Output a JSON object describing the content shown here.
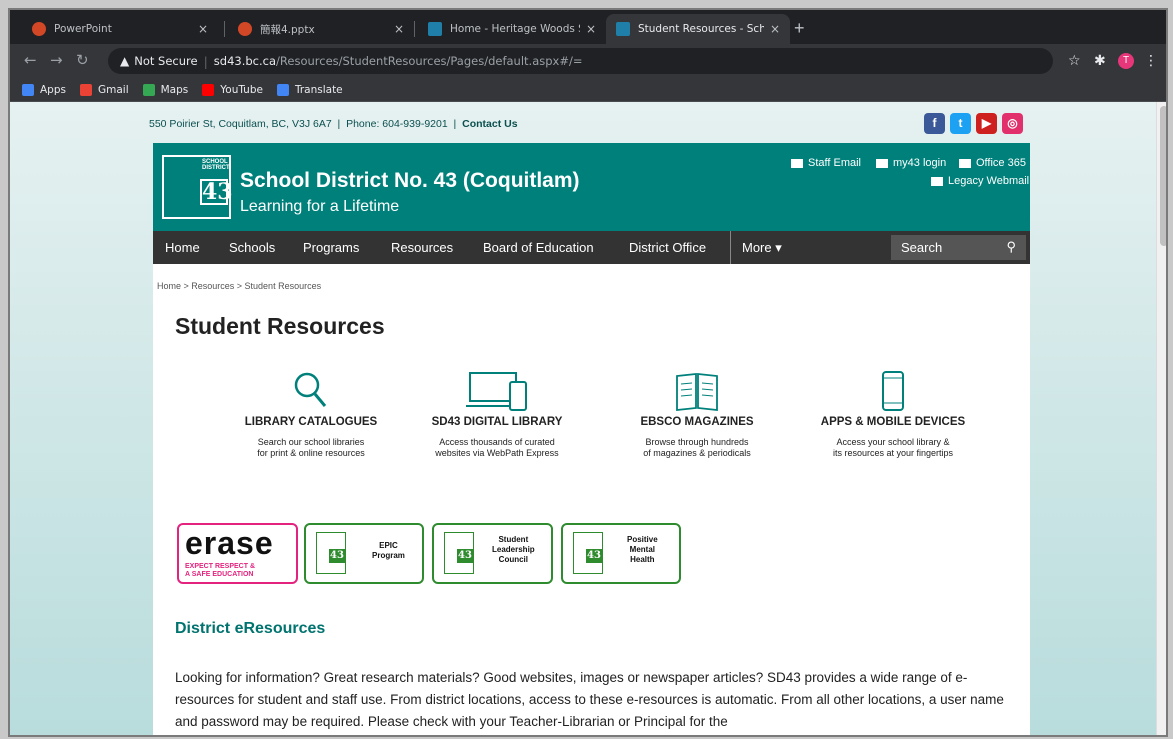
{
  "browser": {
    "tabs": [
      {
        "title": "PowerPoint",
        "icon": "powerpoint-icon",
        "active": false
      },
      {
        "title": "簡報4.pptx",
        "icon": "powerpoint-icon",
        "active": false
      },
      {
        "title": "Home - Heritage Woods Secon",
        "icon": "sd43-favicon",
        "active": false
      },
      {
        "title": "Student Resources - School Di",
        "icon": "sd43-favicon",
        "active": true
      }
    ],
    "new_tab": "+",
    "close_glyph": "×",
    "security": "Not Secure",
    "url_host": "sd43.bc.ca",
    "url_path": "/Resources/StudentResources/Pages/default.aspx#/=",
    "avatar_initial": "T",
    "bookmarks": [
      {
        "label": "Apps",
        "color": "#4285f4"
      },
      {
        "label": "Gmail",
        "color": "#ea4335"
      },
      {
        "label": "Maps",
        "color": "#34a853"
      },
      {
        "label": "YouTube",
        "color": "#ff0000"
      },
      {
        "label": "Translate",
        "color": "#4285f4"
      }
    ]
  },
  "site": {
    "address": "550 Poirier St, Coquitlam, BC, V3J 6A7",
    "phone": "Phone: 604-939-9201",
    "contact": "Contact Us",
    "separator": "|",
    "social": [
      {
        "name": "facebook-icon",
        "glyph": "f",
        "color": "#3b5998"
      },
      {
        "name": "twitter-icon",
        "glyph": "t",
        "color": "#1da1f2"
      },
      {
        "name": "youtube-icon",
        "glyph": "▶",
        "color": "#cd201f"
      },
      {
        "name": "instagram-icon",
        "glyph": "◎",
        "color": "#e1306c"
      }
    ],
    "logo_text": "SCHOOL DISTRICT",
    "logo_number": "43",
    "title": "School District No. 43 (Coquitlam)",
    "subtitle": "Learning for a Lifetime",
    "header_links": {
      "staff_email": "Staff Email",
      "my43": "my43 login",
      "office365": "Office 365",
      "legacy": "Legacy Webmail"
    },
    "nav": [
      "Home",
      "Schools",
      "Programs",
      "Resources",
      "Board of Education",
      "District Office"
    ],
    "more": "More ▾",
    "search_placeholder": "Search",
    "breadcrumb": "Home > Resources > Student Resources",
    "page_title": "Student Resources",
    "features": [
      {
        "title": "LIBRARY CATALOGUES",
        "desc": "Search our school libraries\nfor print & online resources",
        "icon": "magnifier-icon"
      },
      {
        "title": "SD43 DIGITAL LIBRARY",
        "desc": "Access thousands of curated\nwebsites via WebPath Express",
        "icon": "devices-icon"
      },
      {
        "title": "EBSCO MAGAZINES",
        "desc": "Browse through hundreds\nof magazines & periodicals",
        "icon": "open-book-icon"
      },
      {
        "title": "APPS & MOBILE DEVICES",
        "desc": "Access your school library &\nits resources at your fingertips",
        "icon": "phone-icon"
      }
    ],
    "erase": {
      "big": "erase",
      "small": "EXPECT RESPECT &\nA SAFE EDUCATION"
    },
    "badges": [
      {
        "label": "EPIC\nProgram"
      },
      {
        "label": "Student\nLeadership\nCouncil"
      },
      {
        "label": "Positive\nMental\nHealth"
      }
    ],
    "section_title": "District eResources",
    "paragraph": "Looking for information?  Great research materials?  Good websites, images or newspaper articles? SD43 provides a wide range of e-resources for student and staff use.  From district locations, access to these e-resources is automatic.  From all other locations, a user name and password may be required.  Please check with your Teacher-Librarian or Principal for the"
  },
  "colors": {
    "header": "#00807b",
    "nav": "#333333",
    "accent": "#00736f"
  }
}
